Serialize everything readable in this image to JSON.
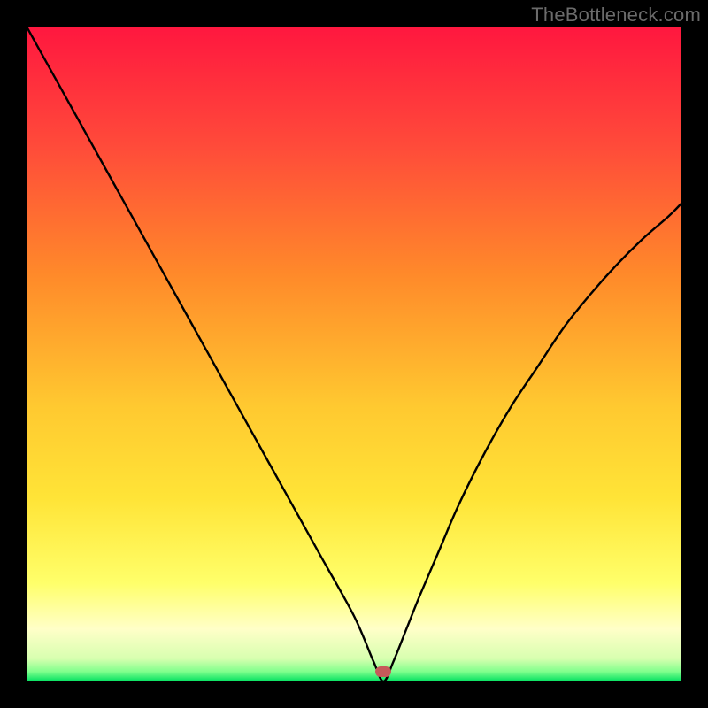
{
  "watermark": "TheBottleneck.com",
  "colors": {
    "black": "#000000",
    "top_red": "#ff173f",
    "mid_orange": "#ff8a2a",
    "yellow": "#ffe437",
    "pale_yellow": "#ffffb0",
    "green": "#00e060",
    "marker": "#c65a5a",
    "curve": "#000000"
  },
  "gradient_stops": [
    {
      "offset": 0.0,
      "color": "#ff173f"
    },
    {
      "offset": 0.18,
      "color": "#ff4a3a"
    },
    {
      "offset": 0.38,
      "color": "#ff8a2a"
    },
    {
      "offset": 0.58,
      "color": "#ffc930"
    },
    {
      "offset": 0.72,
      "color": "#ffe437"
    },
    {
      "offset": 0.85,
      "color": "#ffff6a"
    },
    {
      "offset": 0.92,
      "color": "#ffffc8"
    },
    {
      "offset": 0.965,
      "color": "#d8ffb0"
    },
    {
      "offset": 0.985,
      "color": "#7fff8c"
    },
    {
      "offset": 1.0,
      "color": "#00e060"
    }
  ],
  "chart_data": {
    "type": "line",
    "title": "",
    "xlabel": "",
    "ylabel": "",
    "xlim": [
      0,
      100
    ],
    "ylim": [
      0,
      100
    ],
    "grid": false,
    "note": "Heat-gradient background with a black V-shaped curve. Left branch is near-linear descending; right branch is a concave-up arc. Minimum (marker) lies slightly right of center, at the baseline.",
    "series": [
      {
        "name": "left-branch",
        "x": [
          0,
          5,
          10,
          15,
          20,
          25,
          30,
          35,
          40,
          45,
          50,
          53,
          54.5
        ],
        "y": [
          100,
          91,
          82,
          73,
          64,
          55,
          46,
          37,
          28,
          19,
          10,
          3,
          0
        ]
      },
      {
        "name": "right-branch",
        "x": [
          54.5,
          56,
          58,
          60,
          63,
          66,
          70,
          74,
          78,
          82,
          86,
          90,
          94,
          98,
          100
        ],
        "y": [
          0,
          3,
          8,
          13,
          20,
          27,
          35,
          42,
          48,
          54,
          59,
          63.5,
          67.5,
          71,
          73
        ]
      }
    ],
    "marker": {
      "x": 54.5,
      "y": 1.5
    }
  }
}
